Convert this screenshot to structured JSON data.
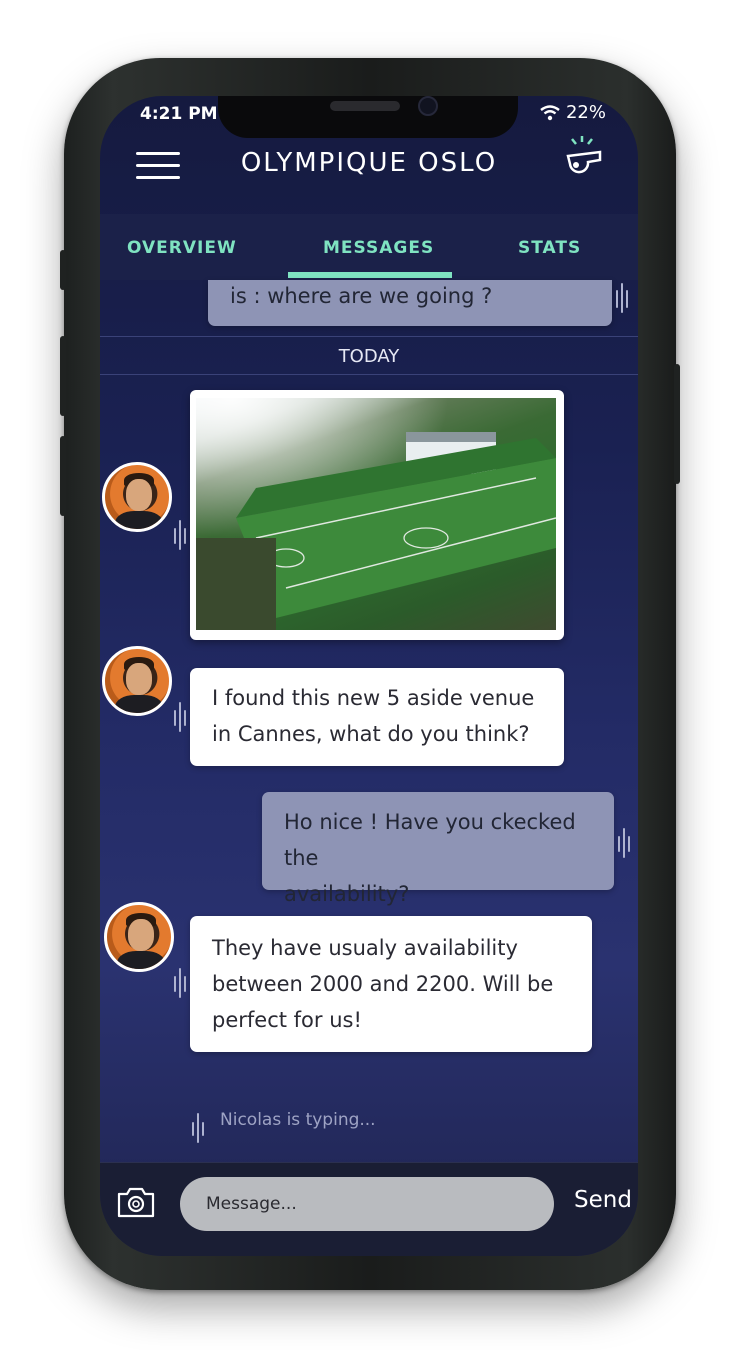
{
  "status": {
    "time": "4:21 PM",
    "battery": "22%"
  },
  "header": {
    "title": "OLYMPIQUE OSLO"
  },
  "tabs": [
    {
      "label": "OVERVIEW"
    },
    {
      "label": "MESSAGES",
      "active": true
    },
    {
      "label": "STATS"
    }
  ],
  "chat": {
    "previous_message": "is : where are we going ?",
    "day_separator": "TODAY",
    "messages": [
      {
        "type": "image",
        "direction": "incoming"
      },
      {
        "type": "text",
        "direction": "incoming",
        "lines": [
          "I found this new 5 aside venue",
          "in Cannes, what do you think?"
        ]
      },
      {
        "type": "text",
        "direction": "outgoing",
        "lines": [
          "Ho nice ! Have you ckecked the",
          "availability?"
        ]
      },
      {
        "type": "text",
        "direction": "incoming",
        "lines": [
          "They have usualy availability",
          "between 2000 and 2200. Will be",
          "perfect for us!"
        ]
      }
    ],
    "typing_indicator": "Nicolas is typing..."
  },
  "composer": {
    "placeholder": "Message...",
    "send_label": "Send"
  },
  "colors": {
    "accent": "#7fe3c1",
    "background": "#1a2152",
    "outgoing_bubble": "#8e94b5"
  },
  "icons": {
    "menu": "hamburger-icon",
    "action": "whistle-icon",
    "attach": "camera-icon",
    "status": "wifi-icon"
  }
}
